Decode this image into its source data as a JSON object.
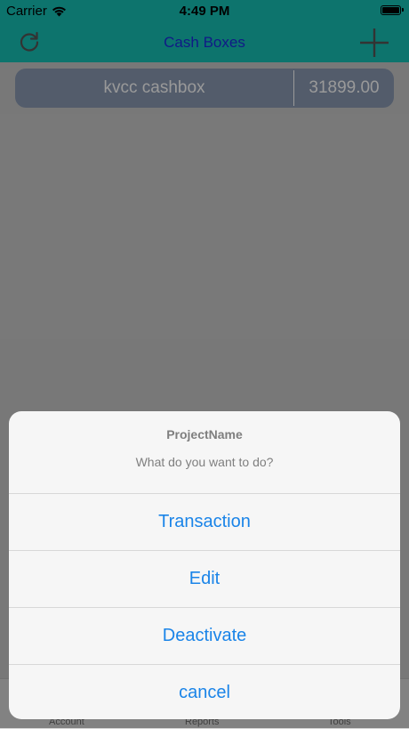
{
  "status_bar": {
    "carrier": "Carrier",
    "time": "4:49 PM"
  },
  "nav": {
    "title": "Cash Boxes",
    "left_icon": "refresh-icon",
    "right_icon": "plus-icon",
    "color": "#17c1b6",
    "title_color": "#1b2de0"
  },
  "cashboxes": [
    {
      "name": "kvcc cashbox",
      "amount": "31899.00"
    }
  ],
  "tabs": [
    {
      "label": "Account"
    },
    {
      "label": "Reports"
    },
    {
      "label": "Tools"
    }
  ],
  "action_sheet": {
    "title": "ProjectName",
    "message": "What do you want to do?",
    "actions": [
      {
        "label": "Transaction"
      },
      {
        "label": "Edit"
      },
      {
        "label": "Deactivate"
      },
      {
        "label": "cancel"
      }
    ],
    "action_color": "#1a84e8"
  }
}
